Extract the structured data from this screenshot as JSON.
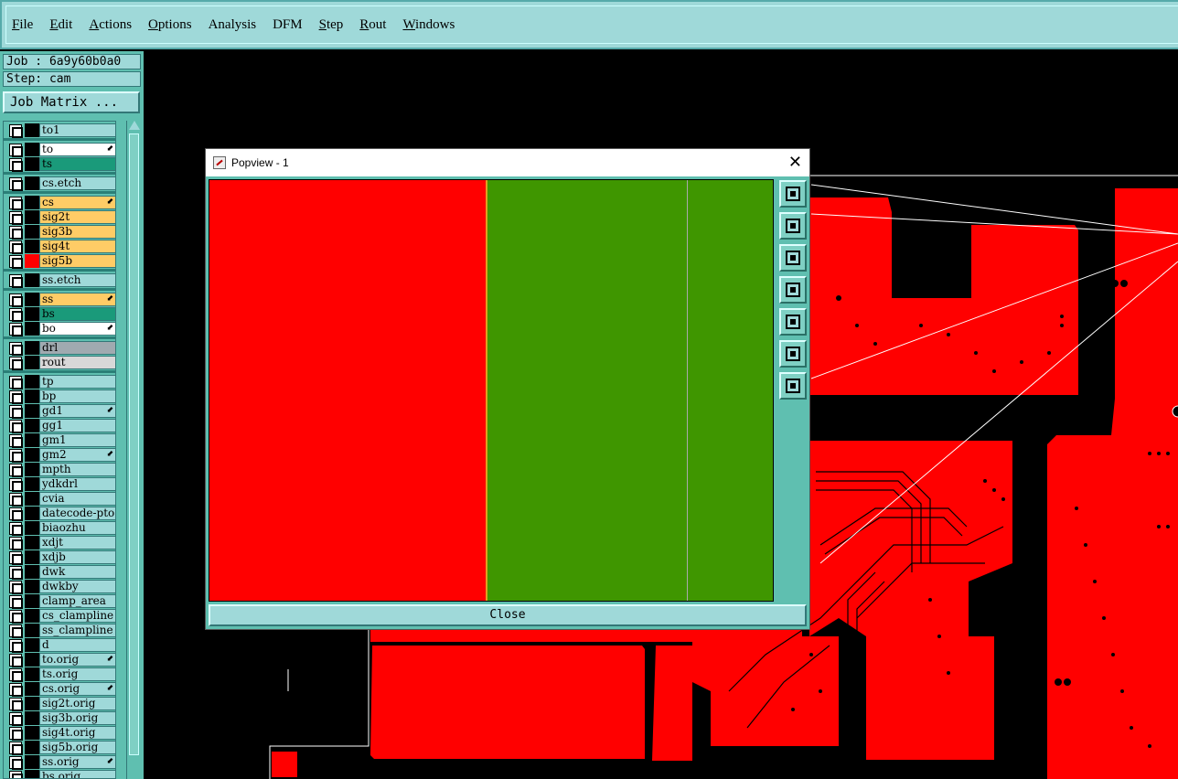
{
  "menu": [
    {
      "label": "File",
      "u": "F",
      "rest": "ile"
    },
    {
      "label": "Edit",
      "u": "E",
      "rest": "dit"
    },
    {
      "label": "Actions",
      "u": "A",
      "rest": "ctions"
    },
    {
      "label": "Options",
      "u": "O",
      "rest": "ptions"
    },
    {
      "label": "Analysis",
      "u": "",
      "rest": "Analysis"
    },
    {
      "label": "DFM",
      "u": "",
      "rest": "DFM"
    },
    {
      "label": "Step",
      "u": "S",
      "rest": "tep"
    },
    {
      "label": "Rout",
      "u": "R",
      "rest": "out"
    },
    {
      "label": "Windows",
      "u": "W",
      "rest": "indows"
    }
  ],
  "job": {
    "label": "Job : 6a9y60b0a0"
  },
  "step": {
    "label": "Step: cam"
  },
  "job_matrix": {
    "label": "Job Matrix ..."
  },
  "layers": [
    {
      "name": "to1",
      "bg": "#9fd9d9",
      "color": "#000",
      "flag": ""
    },
    {
      "name": "to",
      "bg": "#ffffff",
      "color": "#000",
      "flag": "⬋"
    },
    {
      "name": "ts",
      "bg": "#1a9a7a",
      "color": "#000",
      "flag": ""
    },
    {
      "name": "cs.etch",
      "bg": "#9fd9d9",
      "color": "#000",
      "flag": ""
    },
    {
      "name": "cs",
      "bg": "#ffcc66",
      "color": "#000",
      "flag": "⬋"
    },
    {
      "name": "sig2t",
      "bg": "#ffcc66",
      "color": "#000",
      "flag": ""
    },
    {
      "name": "sig3b",
      "bg": "#ffcc66",
      "color": "#000",
      "flag": ""
    },
    {
      "name": "sig4t",
      "bg": "#ffcc66",
      "color": "#000",
      "flag": ""
    },
    {
      "name": "sig5b",
      "bg": "#ffcc66",
      "color": "#ff0000",
      "flag": ""
    },
    {
      "name": "ss.etch",
      "bg": "#9fd9d9",
      "color": "#000",
      "flag": ""
    },
    {
      "name": "ss",
      "bg": "#ffcc66",
      "color": "#000",
      "flag": "⬋"
    },
    {
      "name": "bs",
      "bg": "#1a9a7a",
      "color": "#000",
      "flag": ""
    },
    {
      "name": "bo",
      "bg": "#ffffff",
      "color": "#000",
      "flag": "⬋"
    },
    {
      "name": "drl",
      "bg": "#a0aab0",
      "color": "#000",
      "flag": ""
    },
    {
      "name": "rout",
      "bg": "#d8d8d8",
      "color": "#000",
      "flag": ""
    },
    {
      "name": "tp",
      "bg": "#9fd9d9",
      "color": "#000",
      "flag": ""
    },
    {
      "name": "bp",
      "bg": "#9fd9d9",
      "color": "#000",
      "flag": ""
    },
    {
      "name": "gd1",
      "bg": "#9fd9d9",
      "color": "#000",
      "flag": "⬋"
    },
    {
      "name": "gg1",
      "bg": "#9fd9d9",
      "color": "#000",
      "flag": ""
    },
    {
      "name": "gm1",
      "bg": "#9fd9d9",
      "color": "#000",
      "flag": ""
    },
    {
      "name": "gm2",
      "bg": "#9fd9d9",
      "color": "#000",
      "flag": "⬋"
    },
    {
      "name": "mpth",
      "bg": "#9fd9d9",
      "color": "#000",
      "flag": ""
    },
    {
      "name": "ydkdrl",
      "bg": "#9fd9d9",
      "color": "#000",
      "flag": ""
    },
    {
      "name": "cvia",
      "bg": "#9fd9d9",
      "color": "#000",
      "flag": ""
    },
    {
      "name": "datecode-pto",
      "bg": "#9fd9d9",
      "color": "#000",
      "flag": ""
    },
    {
      "name": "biaozhu",
      "bg": "#9fd9d9",
      "color": "#000",
      "flag": ""
    },
    {
      "name": "xdjt",
      "bg": "#9fd9d9",
      "color": "#000",
      "flag": ""
    },
    {
      "name": "xdjb",
      "bg": "#9fd9d9",
      "color": "#000",
      "flag": ""
    },
    {
      "name": "dwk",
      "bg": "#9fd9d9",
      "color": "#000",
      "flag": ""
    },
    {
      "name": "dwkby",
      "bg": "#9fd9d9",
      "color": "#000",
      "flag": ""
    },
    {
      "name": "clamp_area",
      "bg": "#9fd9d9",
      "color": "#000",
      "flag": ""
    },
    {
      "name": "cs_clampline",
      "bg": "#9fd9d9",
      "color": "#000",
      "flag": ""
    },
    {
      "name": "ss_clampline",
      "bg": "#9fd9d9",
      "color": "#000",
      "flag": ""
    },
    {
      "name": "d",
      "bg": "#9fd9d9",
      "color": "#000",
      "flag": ""
    },
    {
      "name": "to.orig",
      "bg": "#9fd9d9",
      "color": "#000",
      "flag": "⬋"
    },
    {
      "name": "ts.orig",
      "bg": "#9fd9d9",
      "color": "#000",
      "flag": ""
    },
    {
      "name": "cs.orig",
      "bg": "#9fd9d9",
      "color": "#000",
      "flag": "⬋"
    },
    {
      "name": "sig2t.orig",
      "bg": "#9fd9d9",
      "color": "#000",
      "flag": ""
    },
    {
      "name": "sig3b.orig",
      "bg": "#9fd9d9",
      "color": "#000",
      "flag": ""
    },
    {
      "name": "sig4t.orig",
      "bg": "#9fd9d9",
      "color": "#000",
      "flag": ""
    },
    {
      "name": "sig5b.orig",
      "bg": "#9fd9d9",
      "color": "#000",
      "flag": ""
    },
    {
      "name": "ss.orig",
      "bg": "#9fd9d9",
      "color": "#000",
      "flag": "⬋"
    },
    {
      "name": "bs.orig",
      "bg": "#9fd9d9",
      "color": "#000",
      "flag": ""
    }
  ],
  "popview": {
    "title": "Popview - 1",
    "close_label": "Close",
    "tools": [
      "zoom-window-icon",
      "pan-up-icon",
      "pan-down-icon",
      "pan-left-icon",
      "pan-right-icon",
      "zoom-in-icon",
      "zoom-out-icon"
    ]
  },
  "colors": {
    "copper_red": "#ff0000",
    "copper_green": "#3f9600",
    "panel_teal": "#5fbfb0",
    "menu_bg": "#9fd9d9"
  }
}
